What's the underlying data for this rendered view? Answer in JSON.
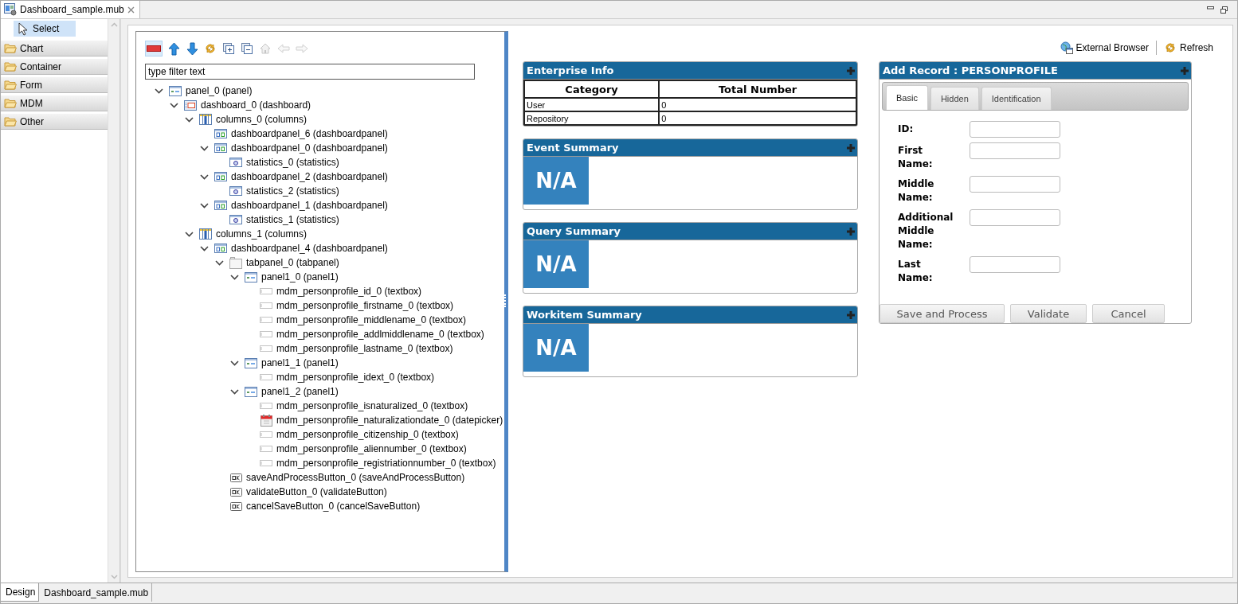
{
  "editor_tab": {
    "title": "Dashboard_sample.mub"
  },
  "palette": {
    "select": {
      "label": "Select",
      "selected": true
    },
    "drawers": [
      {
        "label": "Chart"
      },
      {
        "label": "Container"
      },
      {
        "label": "Form"
      },
      {
        "label": "MDM"
      },
      {
        "label": "Other"
      }
    ]
  },
  "outline": {
    "toolbar": [
      {
        "kind": "remove",
        "disabled": false
      },
      {
        "kind": "up",
        "disabled": false
      },
      {
        "kind": "down",
        "disabled": false
      },
      {
        "kind": "sync",
        "disabled": false
      },
      {
        "kind": "expand",
        "disabled": false
      },
      {
        "kind": "collapse",
        "disabled": false
      },
      {
        "kind": "home",
        "disabled": true
      },
      {
        "kind": "back",
        "disabled": true
      },
      {
        "kind": "forward",
        "disabled": true
      }
    ],
    "filter": {
      "placeholder": "type filter text"
    },
    "tree": [
      {
        "label": "panel_0 (panel)",
        "kind": "panel",
        "expanded": true,
        "children": [
          {
            "label": "dashboard_0 (dashboard)",
            "kind": "dashboard",
            "expanded": true,
            "children": [
              {
                "label": "columns_0 (columns)",
                "kind": "columns",
                "expanded": true,
                "children": [
                  {
                    "label": "dashboardpanel_6 (dashboardpanel)",
                    "kind": "dashboardpanel"
                  },
                  {
                    "label": "dashboardpanel_0 (dashboardpanel)",
                    "kind": "dashboardpanel",
                    "expanded": true,
                    "children": [
                      {
                        "label": "statistics_0 (statistics)",
                        "kind": "statistics"
                      }
                    ]
                  },
                  {
                    "label": "dashboardpanel_2 (dashboardpanel)",
                    "kind": "dashboardpanel",
                    "expanded": true,
                    "children": [
                      {
                        "label": "statistics_2 (statistics)",
                        "kind": "statistics"
                      }
                    ]
                  },
                  {
                    "label": "dashboardpanel_1 (dashboardpanel)",
                    "kind": "dashboardpanel",
                    "expanded": true,
                    "children": [
                      {
                        "label": "statistics_1 (statistics)",
                        "kind": "statistics"
                      }
                    ]
                  }
                ]
              },
              {
                "label": "columns_1 (columns)",
                "kind": "columns",
                "expanded": true,
                "children": [
                  {
                    "label": "dashboardpanel_4 (dashboardpanel)",
                    "kind": "dashboardpanel",
                    "expanded": true,
                    "children": [
                      {
                        "label": "tabpanel_0 (tabpanel)",
                        "kind": "tabpanel",
                        "expanded": true,
                        "children": [
                          {
                            "label": "panel1_0 (panel1)",
                            "kind": "panel",
                            "expanded": true,
                            "children": [
                              {
                                "label": "mdm_personprofile_id_0 (textbox)",
                                "kind": "textbox"
                              },
                              {
                                "label": "mdm_personprofile_firstname_0 (textbox)",
                                "kind": "textbox"
                              },
                              {
                                "label": "mdm_personprofile_middlename_0 (textbox)",
                                "kind": "textbox"
                              },
                              {
                                "label": "mdm_personprofile_addlmiddlename_0 (textbox)",
                                "kind": "textbox"
                              },
                              {
                                "label": "mdm_personprofile_lastname_0 (textbox)",
                                "kind": "textbox"
                              }
                            ]
                          },
                          {
                            "label": "panel1_1 (panel1)",
                            "kind": "panel",
                            "expanded": true,
                            "children": [
                              {
                                "label": "mdm_personprofile_idext_0 (textbox)",
                                "kind": "textbox"
                              }
                            ]
                          },
                          {
                            "label": "panel1_2 (panel1)",
                            "kind": "panel",
                            "expanded": true,
                            "children": [
                              {
                                "label": "mdm_personprofile_isnaturalized_0 (textbox)",
                                "kind": "textbox"
                              },
                              {
                                "label": "mdm_personprofile_naturalizationdate_0 (datepicker)",
                                "kind": "datepicker"
                              },
                              {
                                "label": "mdm_personprofile_citizenship_0 (textbox)",
                                "kind": "textbox"
                              },
                              {
                                "label": "mdm_personprofile_aliennumber_0 (textbox)",
                                "kind": "textbox"
                              },
                              {
                                "label": "mdm_personprofile_registriationnumber_0 (textbox)",
                                "kind": "textbox"
                              }
                            ]
                          }
                        ]
                      },
                      {
                        "label": "saveAndProcessButton_0 (saveAndProcessButton)",
                        "kind": "button"
                      },
                      {
                        "label": "validateButton_0 (validateButton)",
                        "kind": "button"
                      },
                      {
                        "label": "cancelSaveButton_0 (cancelSaveButton)",
                        "kind": "button"
                      }
                    ]
                  }
                ]
              }
            ]
          }
        ]
      }
    ]
  },
  "preview": {
    "toolbar": [
      {
        "label": "External Browser",
        "kind": "browser"
      },
      {
        "label": "Refresh",
        "kind": "refresh"
      }
    ],
    "enterprise_info": {
      "title": "Enterprise Info",
      "columns": [
        "Category",
        "Total Number"
      ],
      "rows": [
        [
          "User",
          "0"
        ],
        [
          "Repository",
          "0"
        ]
      ]
    },
    "summaries": [
      {
        "title": "Event Summary",
        "value": "N/A"
      },
      {
        "title": "Query Summary",
        "value": "N/A"
      },
      {
        "title": "Workitem Summary",
        "value": "N/A"
      }
    ],
    "add_record": {
      "title": "Add Record : PERSONPROFILE",
      "tabs": [
        {
          "label": "Basic",
          "selected": true
        },
        {
          "label": "Hidden",
          "selected": false
        },
        {
          "label": "Identification",
          "selected": false
        }
      ],
      "fields": [
        {
          "label": "ID:"
        },
        {
          "label": "First Name:"
        },
        {
          "label": "Middle Name:"
        },
        {
          "label": "Additional Middle Name:"
        },
        {
          "label": "Last Name:"
        }
      ],
      "buttons": [
        "Save and Process",
        "Validate",
        "Cancel"
      ]
    }
  },
  "bottom_tabs": [
    {
      "label": "Design",
      "selected": true
    },
    {
      "label": "Dashboard_sample.mub",
      "selected": false
    }
  ]
}
